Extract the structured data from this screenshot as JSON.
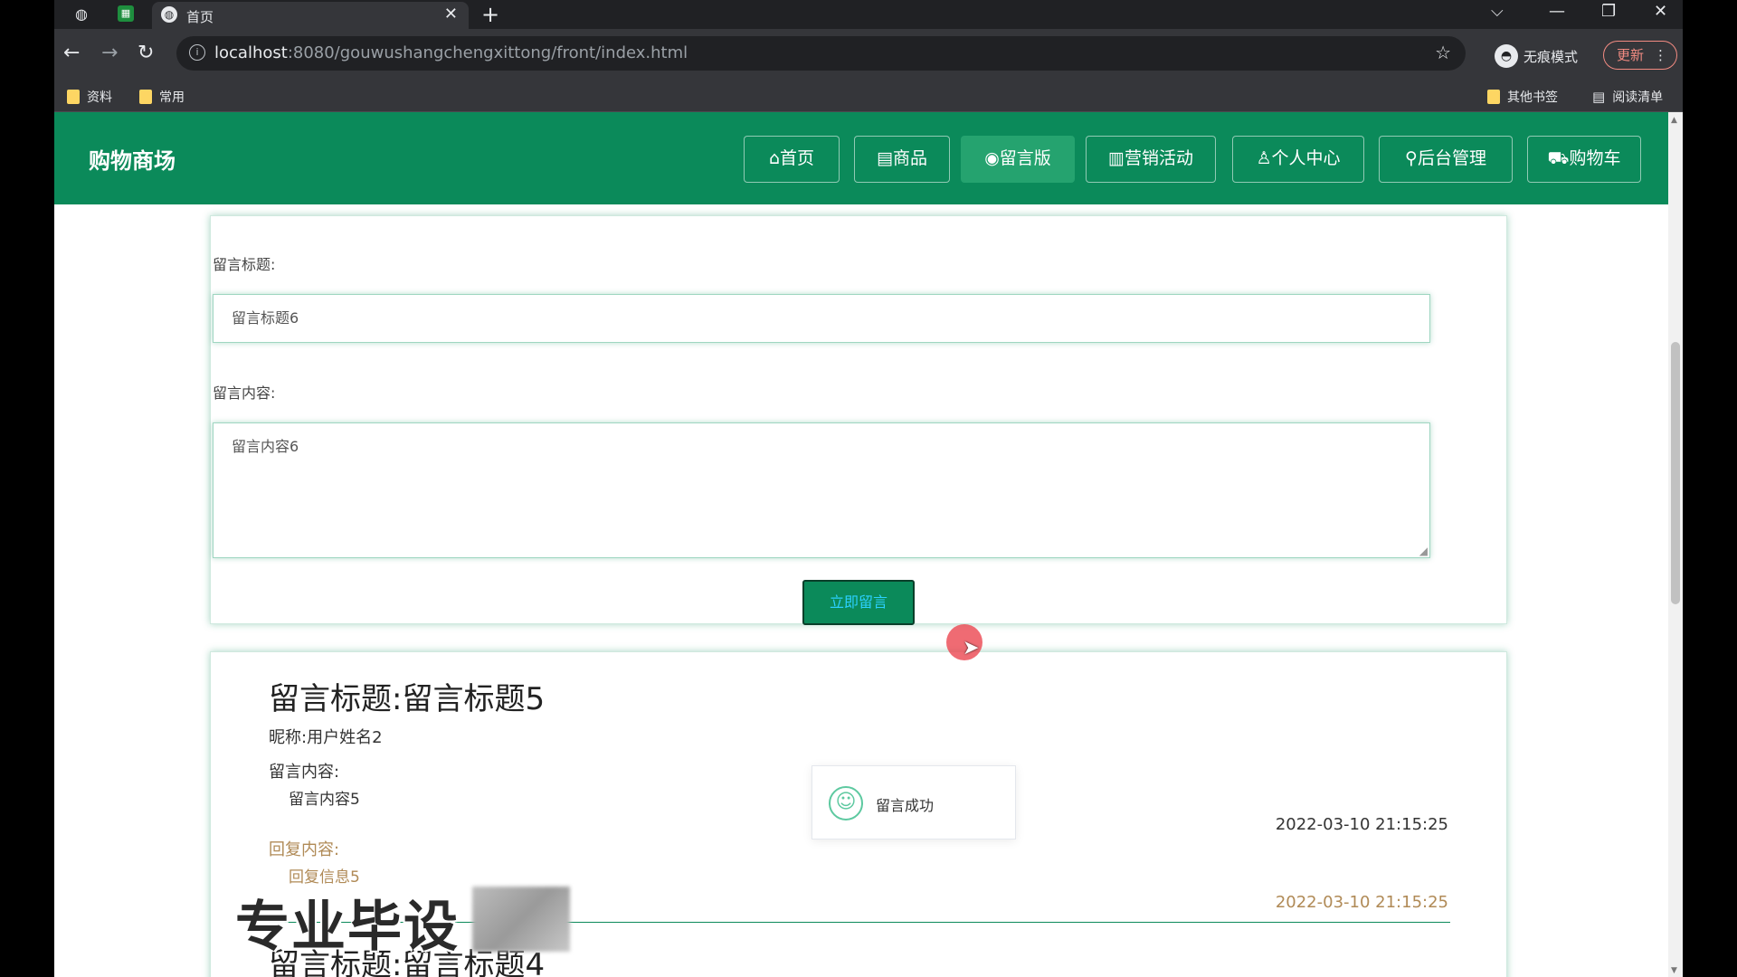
{
  "browser": {
    "tab_title": "首页",
    "url_host": "localhost",
    "url_path": ":8080/gouwushangchengxittong/front/index.html",
    "incognito_label": "无痕模式",
    "update_label": "更新",
    "bookmarks": [
      "资料",
      "常用"
    ],
    "bookmarks_right": [
      "其他书签",
      "阅读清单"
    ]
  },
  "site": {
    "brand": "购物商场",
    "nav": [
      {
        "icon": "⌂",
        "label": "首页"
      },
      {
        "icon": "▤",
        "label": "商品"
      },
      {
        "icon": "◉",
        "label": "留言版"
      },
      {
        "icon": "▥",
        "label": "营销活动"
      },
      {
        "icon": "♙",
        "label": "个人中心"
      },
      {
        "icon": "⚲",
        "label": "后台管理"
      },
      {
        "icon": "⛟",
        "label": "购物车"
      }
    ],
    "accent_color": "#0b8a5a"
  },
  "form": {
    "title_label": "留言标题:",
    "title_value": "留言标题6",
    "content_label": "留言内容:",
    "content_value": "留言内容6",
    "submit_label": "立即留言"
  },
  "messages": [
    {
      "title": "留言标题:留言标题5",
      "nickname": "昵称:用户姓名2",
      "content_label": "留言内容:",
      "content": "留言内容5",
      "time": "2022-03-10 21:15:25",
      "reply_label": "回复内容:",
      "reply": "回复信息5",
      "reply_time": "2022-03-10 21:15:25"
    },
    {
      "title": "留言标题:留言标题4"
    }
  ],
  "toast": {
    "text": "留言成功"
  },
  "watermark": "专业毕设"
}
